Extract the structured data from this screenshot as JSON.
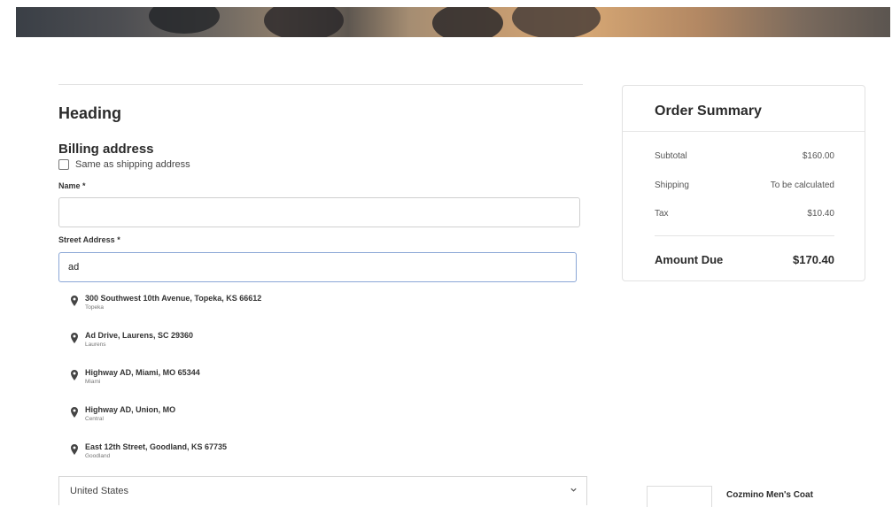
{
  "form": {
    "heading": "Heading",
    "billing_title": "Billing address",
    "same_as_shipping_label": "Same as shipping address",
    "name_label": "Name *",
    "name_value": "",
    "street_label": "Street Address *",
    "street_value": "ad",
    "country_value": "United States"
  },
  "suggestions": [
    {
      "main": "300 Southwest 10th Avenue, Topeka, KS 66612",
      "sub": "Topeka"
    },
    {
      "main": "Ad Drive, Laurens, SC 29360",
      "sub": "Laurens"
    },
    {
      "main": "Highway AD, Miami, MO 65344",
      "sub": "Miami"
    },
    {
      "main": "Highway AD, Union, MO",
      "sub": "Central"
    },
    {
      "main": "East 12th Street, Goodland, KS 67735",
      "sub": "Goodland"
    }
  ],
  "summary": {
    "title": "Order Summary",
    "subtotal_label": "Subtotal",
    "subtotal_value": "$160.00",
    "shipping_label": "Shipping",
    "shipping_value": "To be calculated",
    "tax_label": "Tax",
    "tax_value": "$10.40",
    "due_label": "Amount Due",
    "due_value": "$170.40"
  },
  "product": {
    "name": "Cozmino Men's Coat"
  },
  "icons": {
    "suggestion": "location-pin-icon",
    "select": "chevron-down-icon"
  }
}
